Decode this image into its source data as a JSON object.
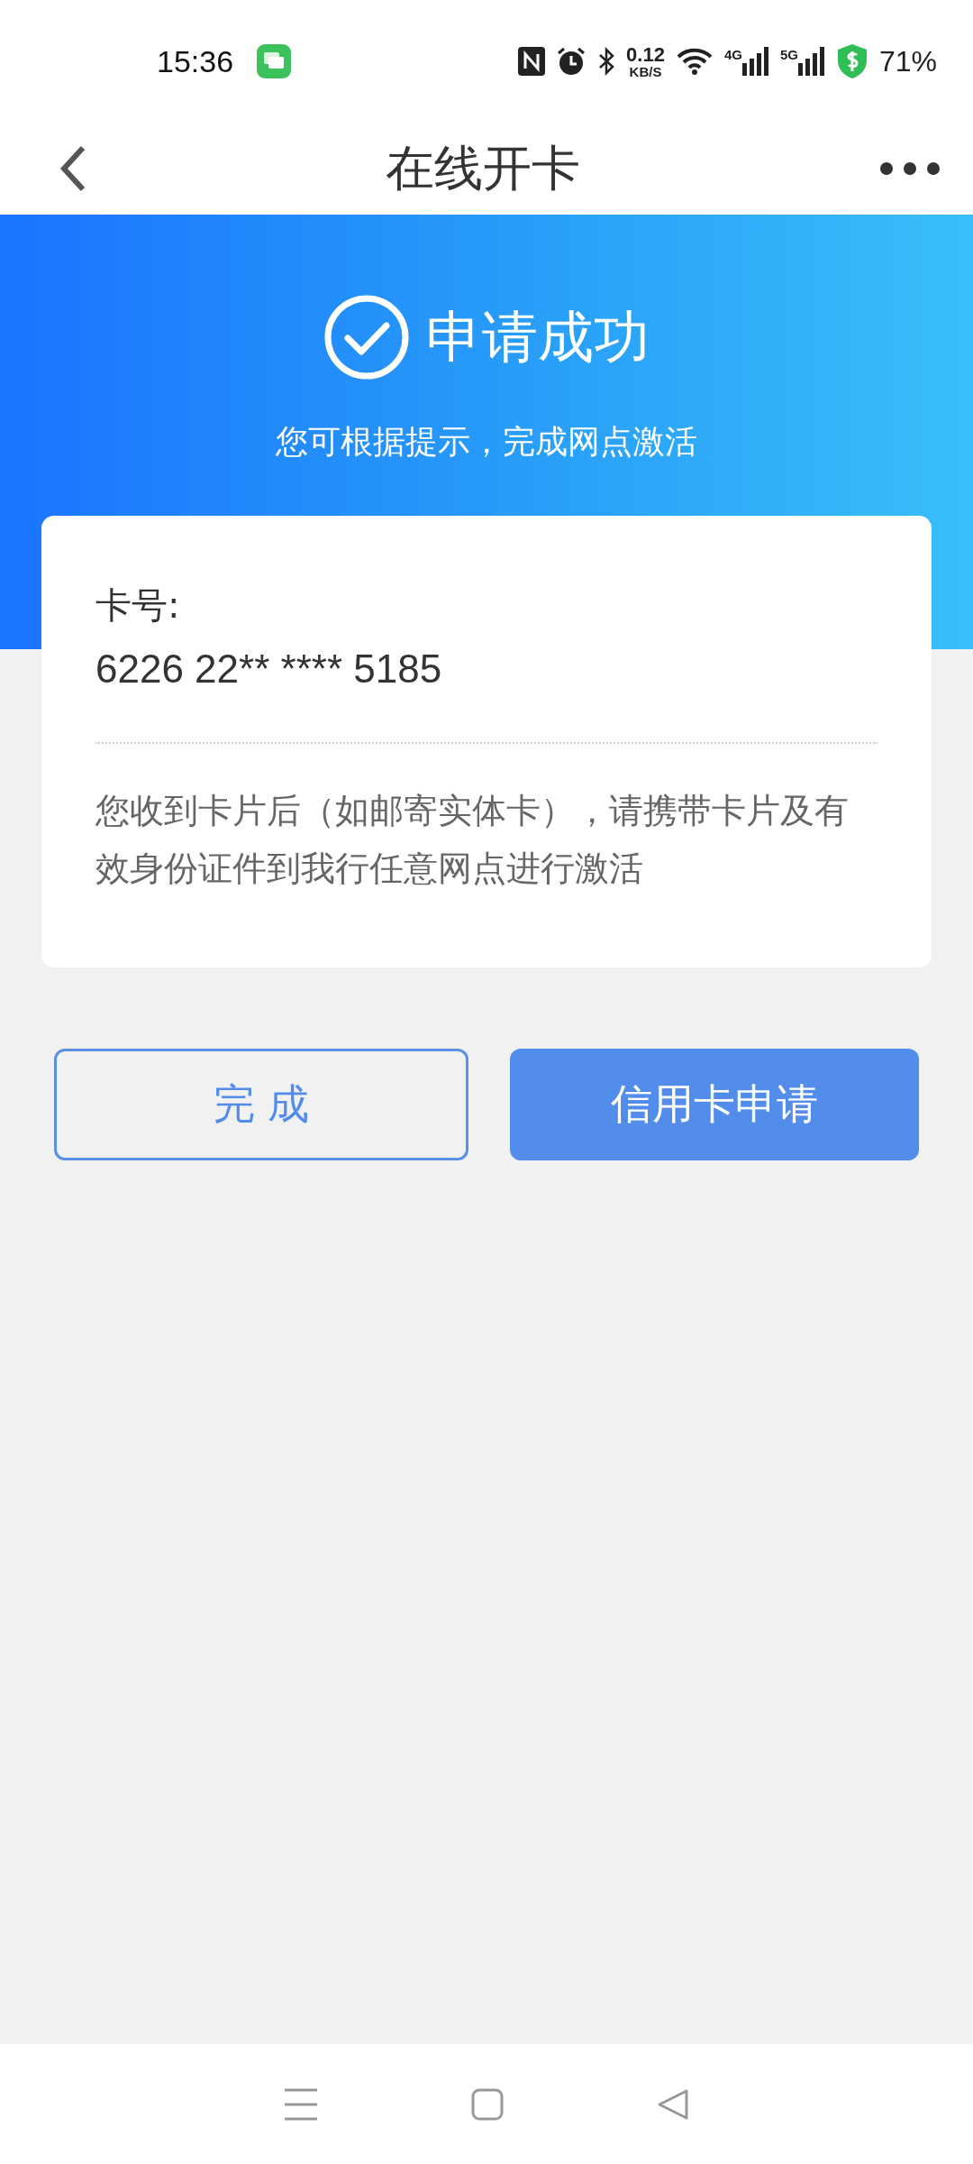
{
  "status_bar": {
    "time": "15:36",
    "net_speed": "0.12",
    "net_unit": "KB/S",
    "signal_1": "4G",
    "signal_2": "5G",
    "battery": "71%"
  },
  "header": {
    "title": "在线开卡"
  },
  "banner": {
    "title": "申请成功",
    "subtitle": "您可根据提示，完成网点激活"
  },
  "card": {
    "label": "卡号:",
    "number": "6226 22** **** 5185",
    "note": "您收到卡片后（如邮寄实体卡），请携带卡片及有效身份证件到我行任意网点进行激活"
  },
  "buttons": [
    {
      "label": "完 成",
      "kind": "outline"
    },
    {
      "label": "信用卡申请",
      "kind": "primary"
    }
  ]
}
